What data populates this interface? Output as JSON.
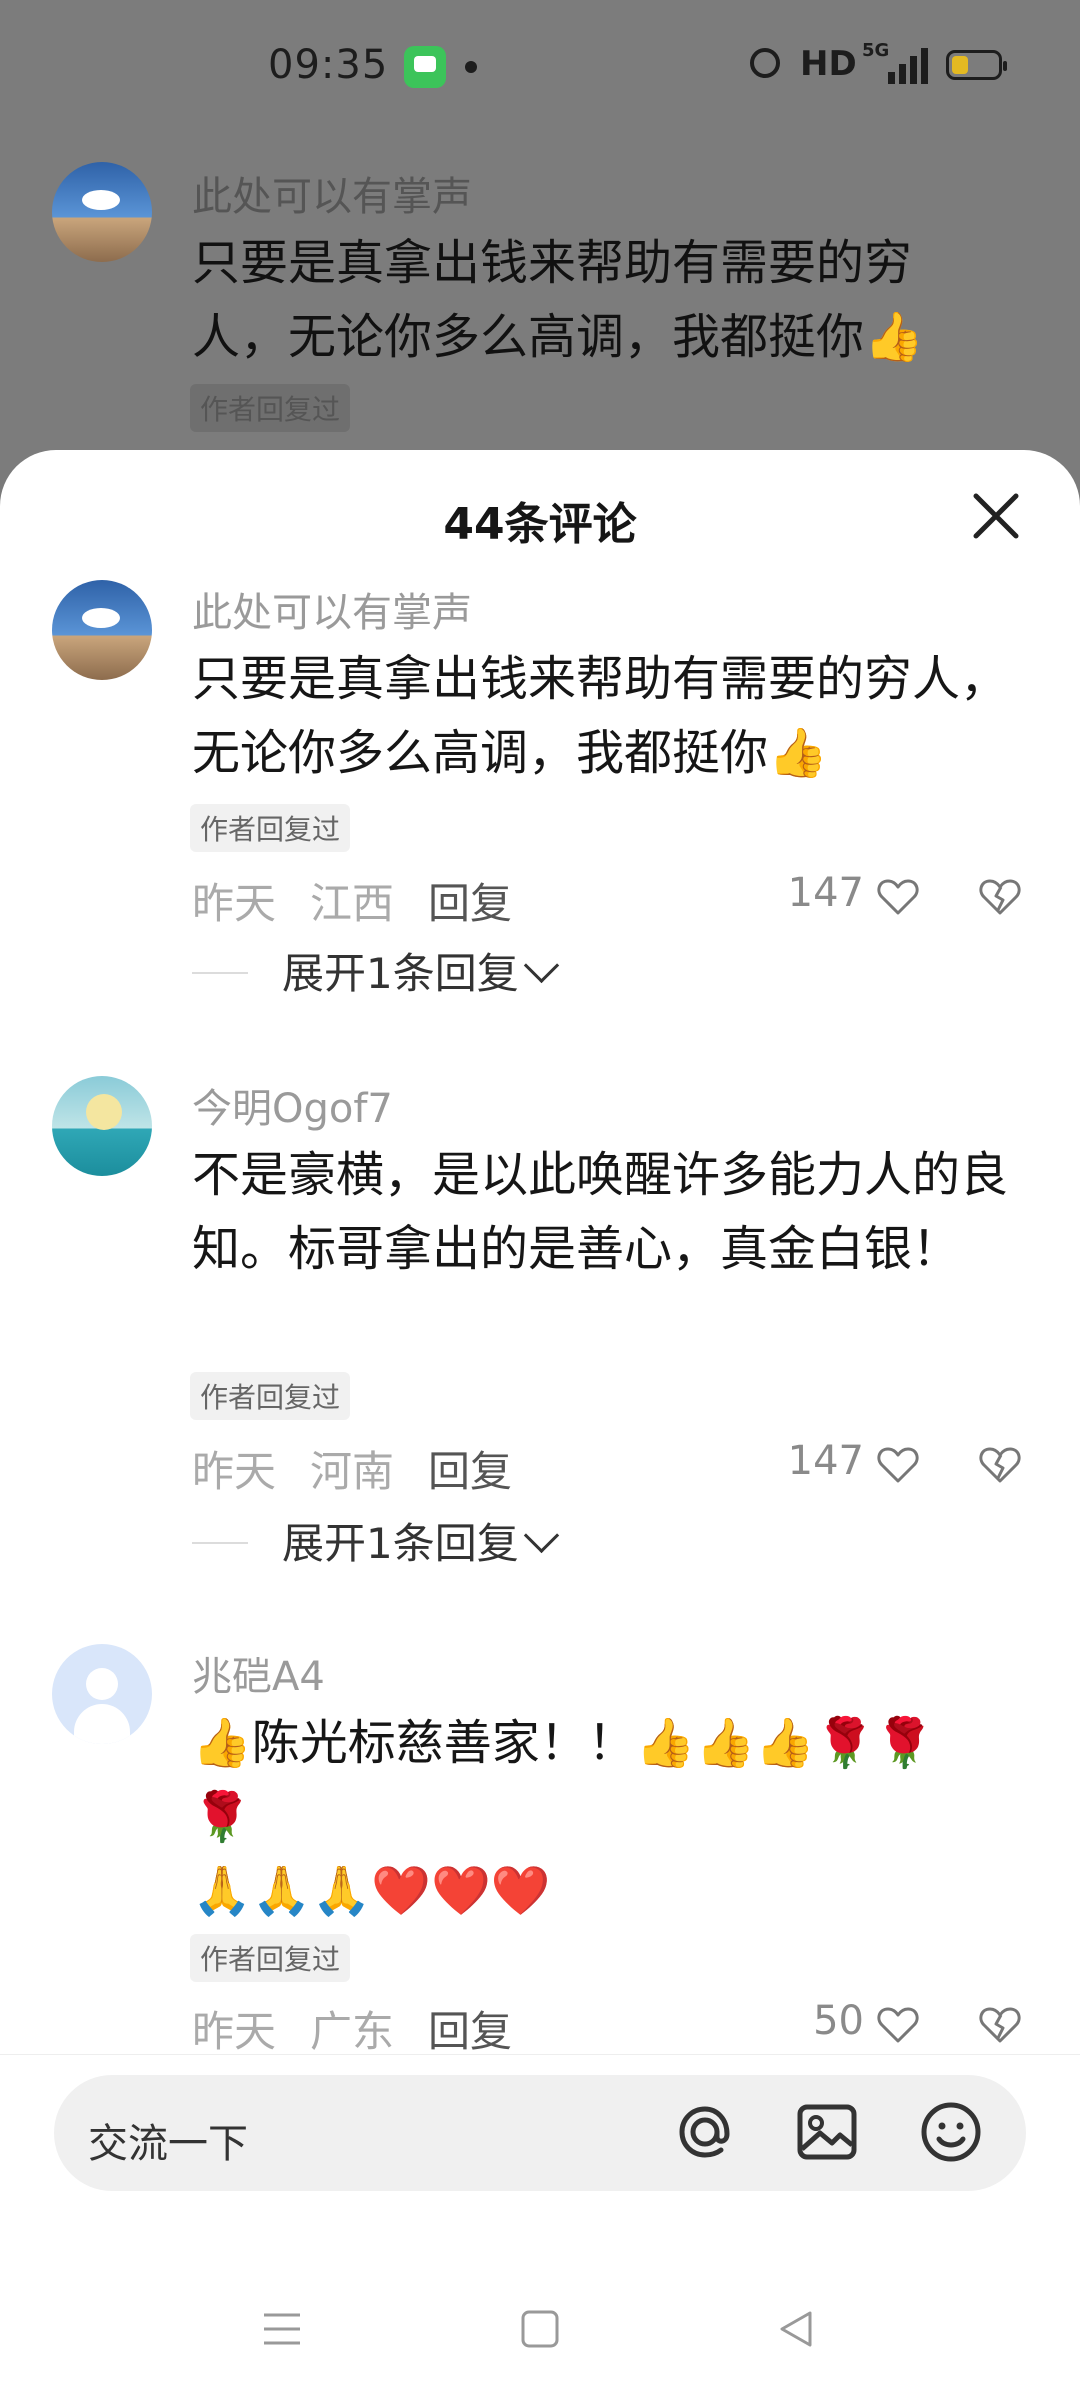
{
  "status_bar": {
    "time": "09:35",
    "network": "HD",
    "network_gen": "5G"
  },
  "background_comment": {
    "username": "此处可以有掌声",
    "text": "只要是真拿出钱来帮助有需要的穷人，无论你多么高调，我都挺你👍",
    "author_tag": "作者回复过"
  },
  "sheet": {
    "title": "44条评论",
    "close_icon": "close-icon"
  },
  "comments": [
    {
      "username": "此处可以有掌声",
      "text": "只要是真拿出钱来帮助有需要的穷人，无论你多么高调，我都挺你👍",
      "author_tag": "作者回复过",
      "time": "昨天",
      "location": "江西",
      "reply_label": "回复",
      "likes": "147",
      "expand_label": "展开1条回复"
    },
    {
      "username": "今明Ogof7",
      "text": "不是豪横，是以此唤醒许多能力人的良知。标哥拿出的是善心，真金白银！",
      "author_tag": "作者回复过",
      "time": "昨天",
      "location": "河南",
      "reply_label": "回复",
      "likes": "147",
      "expand_label": "展开1条回复"
    },
    {
      "username": "兆硙A4",
      "text_line1": "👍陈光标慈善家！！👍👍👍🌹🌹",
      "text_line2": "🌹",
      "text_line3": "🙏🙏🙏❤️❤️❤️",
      "author_tag": "作者回复过",
      "time": "昨天",
      "location": "广东",
      "reply_label": "回复",
      "likes": "50"
    }
  ],
  "input_bar": {
    "placeholder": "交流一下",
    "icons": [
      "at-icon",
      "image-icon",
      "emoji-icon"
    ]
  },
  "nav_bar": {
    "icons": [
      "menu-icon",
      "home-icon",
      "back-icon"
    ]
  }
}
